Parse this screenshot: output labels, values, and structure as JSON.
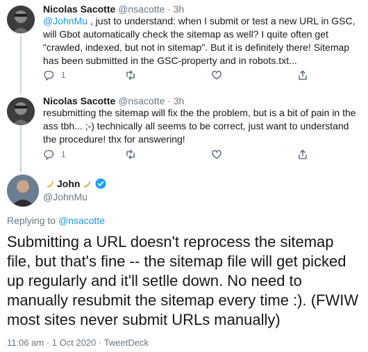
{
  "replies": [
    {
      "name": "Nicolas Sacotte",
      "handle": "@nsacotte",
      "sep": "·",
      "time": "3h",
      "mention": "@JohnMu",
      "text": " , just to understand: when I submit or test a new URL in GSC, will Gbot automatically check the sitemap as well? I quite often get \"crawled, indexed, but not in sitemap\". But it is definitely there! Sitemap has been submitted in the GSC-property and in robots.txt...",
      "reply_count": "1"
    },
    {
      "name": "Nicolas Sacotte",
      "handle": "@nsacotte",
      "sep": "·",
      "time": "3h",
      "text": "resubmitting the sitemap will fix the the problem, but is a bit of pain in the ass tbh... ;-) technically all seems to be correct, just want to understand the procedure! thx for answering!",
      "reply_count": "1"
    }
  ],
  "main_tweet": {
    "name": "John",
    "handle": "@JohnMu",
    "replying_prefix": "Replying to ",
    "replying_to": "@nsacotte",
    "text": "Submitting a URL doesn't reprocess the sitemap file, but that's fine -- the sitemap file will get picked up regularly and it'll setlle down. No need to manually resubmit the sitemap every time :). (FWIW most sites never submit URLs manually)",
    "timestamp": "11:06 am · 1 Oct 2020 · TweetDeck"
  },
  "colors": {
    "link": "#1b95e0",
    "muted": "#657786",
    "text": "#14171a",
    "verified": "#1da1f2",
    "banana": "#f5c842"
  },
  "icons": [
    "reply-icon",
    "retweet-icon",
    "like-icon",
    "share-icon",
    "verified-badge-icon",
    "banana-emoji-icon"
  ]
}
